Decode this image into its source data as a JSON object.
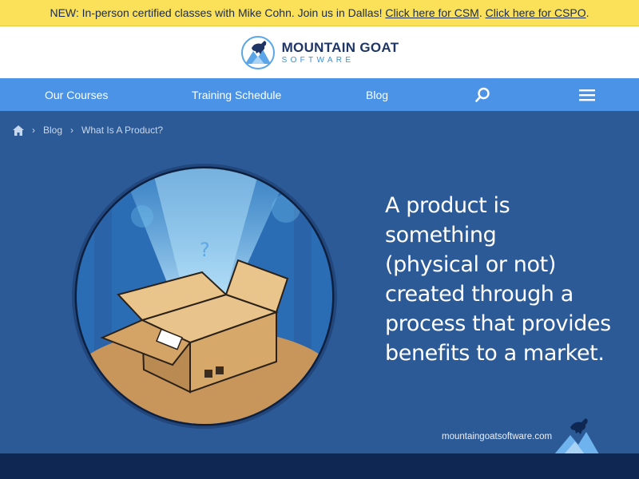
{
  "announcement": {
    "text": "NEW: In-person certified classes with Mike Cohn. Join us in Dallas! ",
    "link_csm": "Click here for CSM",
    "separator": ". ",
    "link_cspo": "Click here for CSPO",
    "suffix": "."
  },
  "brand": {
    "title": "MOUNTAIN GOAT",
    "subtitle": "SOFTWARE"
  },
  "nav": {
    "courses": "Our Courses",
    "schedule": "Training Schedule",
    "blog": "Blog",
    "search_icon": "search-icon",
    "menu_icon": "hamburger-menu-icon"
  },
  "breadcrumb": {
    "home_icon": "home-icon",
    "blog": "Blog",
    "current": "What Is A Product?"
  },
  "hero": {
    "lines": [
      "A product is",
      "something",
      "(physical or not)",
      "created through a",
      "process that provides",
      "benefits to a market."
    ],
    "watermark": "mountaingoatsoftware.com"
  },
  "colors": {
    "announcement_bg": "#fbe05a",
    "nav_bg": "#4a93e6",
    "hero_bg": "#2c5a96",
    "footer_bg": "#0f2753",
    "brand_navy": "#1e3566",
    "brand_blue": "#3c8fd8"
  }
}
